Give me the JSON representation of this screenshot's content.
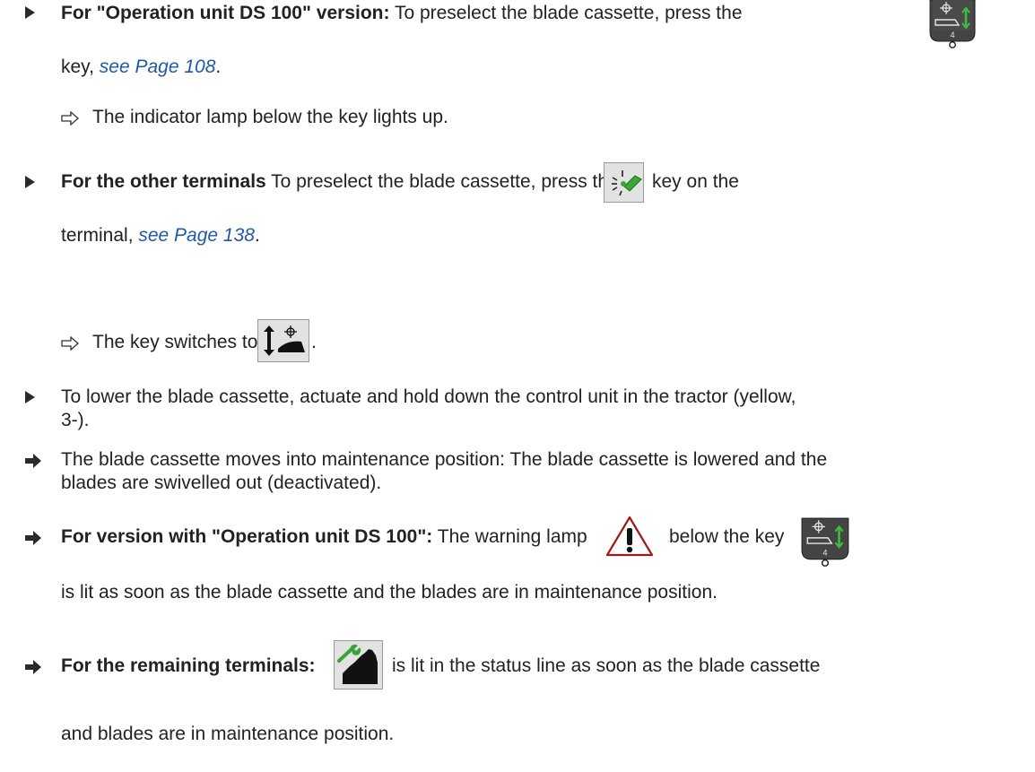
{
  "items": [
    {
      "bold": "For \"Operation unit DS 100\" version:",
      "text": " To preselect the blade cassette, press the",
      "cont_a": "key, ",
      "link": "see Page 108",
      "cont_b": "."
    },
    {
      "result": "The indicator lamp below the key lights up."
    },
    {
      "bold": "For the other terminals",
      "text": " To preselect the blade cassette, press the",
      "after_key": "key on the",
      "cont_a": "terminal, ",
      "link": "see Page 138",
      "cont_b": "."
    },
    {
      "result_pre": "The key switches to",
      "result_post": "."
    },
    {
      "line1": "To lower the blade cassette, actuate and hold down the control unit in the tractor (yellow,",
      "line2": "3-)."
    },
    {
      "line1": "The blade cassette moves into maintenance position: The blade cassette is lowered and the",
      "line2": "blades are swivelled out (deactivated)."
    },
    {
      "bold": "For version with \"Operation unit DS 100\":",
      "text": " The warning lamp",
      "after_lamp": "below the key",
      "cont": "is lit as soon as the blade cassette and the blades are in maintenance position."
    },
    {
      "bold": "For the remaining terminals:",
      "text": "is lit in the status line as soon as the blade cassette",
      "cont": "and blades are in maintenance position."
    }
  ],
  "key_label": "4",
  "colors": {
    "link": "#1f5aa6",
    "green": "#2ea043",
    "warning_red": "#a01818"
  }
}
